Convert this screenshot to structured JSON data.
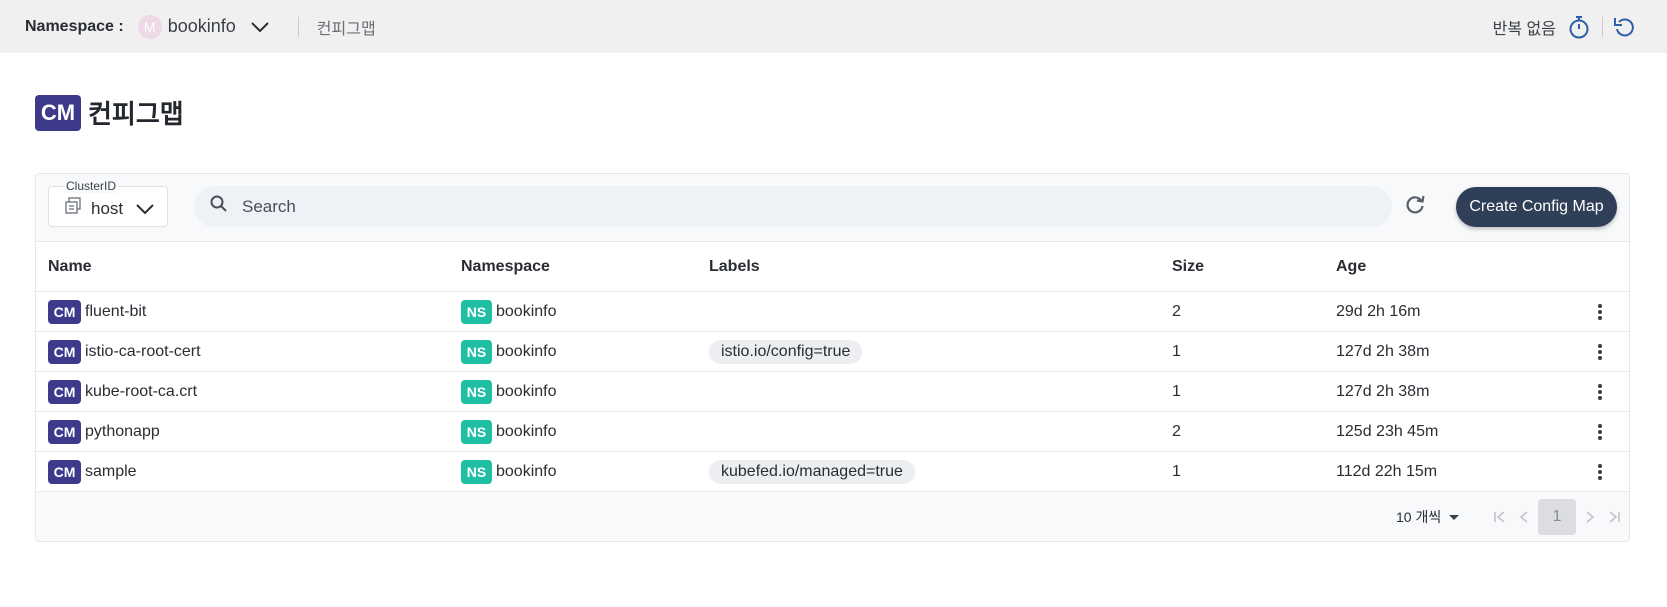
{
  "topbar": {
    "namespace_label": "Namespace :",
    "namespace_avatar": "M",
    "namespace_value": "bookinfo",
    "breadcrumb": "컨피그맵",
    "repeat_label": "반복 없음"
  },
  "page": {
    "badge": "CM",
    "title": "컨피그맵"
  },
  "toolbar": {
    "cluster_caption": "ClusterID",
    "cluster_value": "host",
    "search_placeholder": "Search",
    "create_label": "Create Config Map"
  },
  "table": {
    "columns": [
      "Name",
      "Namespace",
      "Labels",
      "Size",
      "Age"
    ],
    "rows": [
      {
        "kind": "CM",
        "name": "fluent-bit",
        "ns_kind": "NS",
        "namespace": "bookinfo",
        "label": "",
        "size": "2",
        "age": "29d 2h 16m"
      },
      {
        "kind": "CM",
        "name": "istio-ca-root-cert",
        "ns_kind": "NS",
        "namespace": "bookinfo",
        "label": "istio.io/config=true",
        "size": "1",
        "age": "127d 2h 38m"
      },
      {
        "kind": "CM",
        "name": "kube-root-ca.crt",
        "ns_kind": "NS",
        "namespace": "bookinfo",
        "label": "",
        "size": "1",
        "age": "127d 2h 38m"
      },
      {
        "kind": "CM",
        "name": "pythonapp",
        "ns_kind": "NS",
        "namespace": "bookinfo",
        "label": "",
        "size": "2",
        "age": "125d 23h 45m"
      },
      {
        "kind": "CM",
        "name": "sample",
        "ns_kind": "NS",
        "namespace": "bookinfo",
        "label": "kubefed.io/managed=true",
        "size": "1",
        "age": "112d 22h 15m"
      }
    ]
  },
  "pagination": {
    "per_page": "10 개씩",
    "current_page": "1"
  },
  "icons": {
    "timer": "stopwatch-icon",
    "undo": "undo-icon",
    "search": "search-icon",
    "refresh": "refresh-icon",
    "cluster": "cluster-icon",
    "menu": "kebab-menu-icon"
  },
  "colors": {
    "cm_badge": "#3d3a8c",
    "ns_badge": "#20bfa5",
    "primary_button": "#2f3f58",
    "accent_icon": "#2f5fa8"
  }
}
